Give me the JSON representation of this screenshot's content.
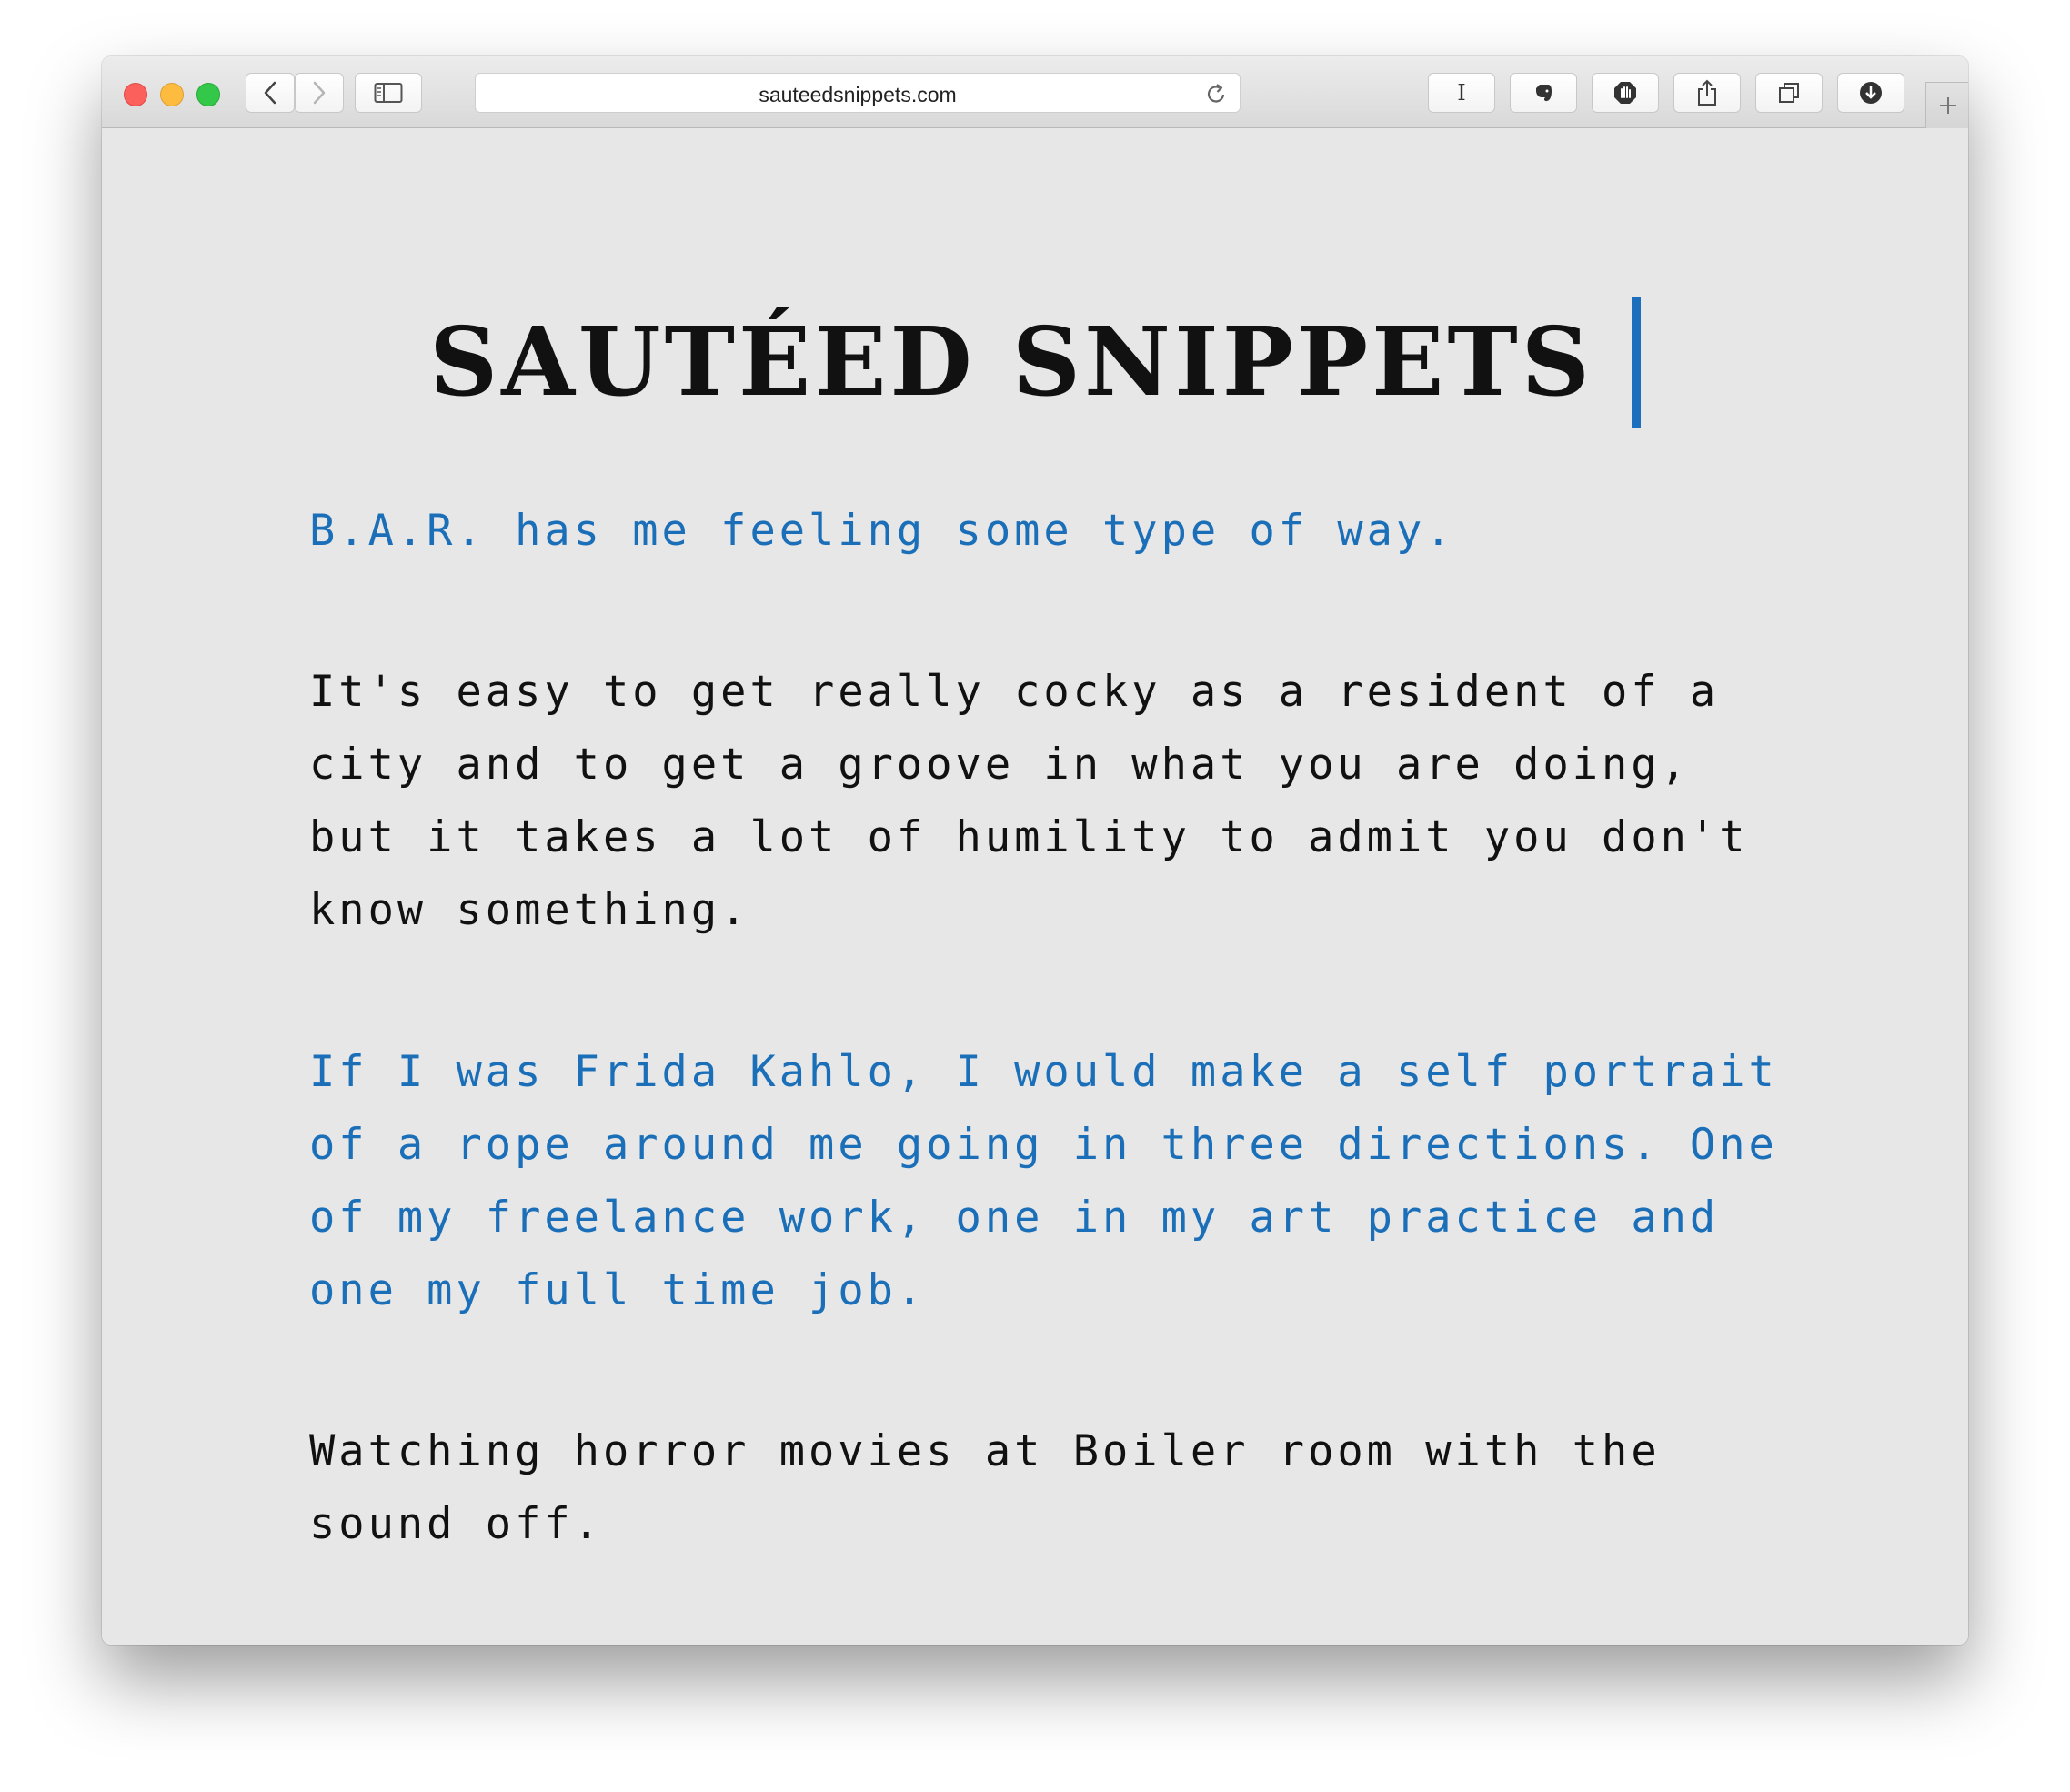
{
  "browser": {
    "url": "sauteedsnippets.com",
    "toolbar_buttons": [
      "back-icon",
      "forward-icon",
      "sidebar-icon",
      "reader-icon",
      "evernote-icon",
      "adblock-icon",
      "share-icon",
      "tabs-icon",
      "download-icon"
    ],
    "reader_label": "I"
  },
  "site": {
    "title": "SAUTÉED SNIPPETS",
    "accent_color": "#1c6fbd"
  },
  "posts": [
    {
      "text": "B.A.R. has me feeling some type of way.",
      "color": "blue"
    },
    {
      "text": "It's easy to get really cocky as a resident of a city and to get a groove in what you are doing, but it takes a lot of humility to admit you don't know something.",
      "color": "black"
    },
    {
      "text": "If I was Frida Kahlo, I would make a self portrait of a rope around me going in three directions. One of my freelance work, one in my art practice and one my full time job.",
      "color": "blue"
    },
    {
      "text": "Watching horror movies at Boiler room with the sound off.",
      "color": "black"
    }
  ]
}
